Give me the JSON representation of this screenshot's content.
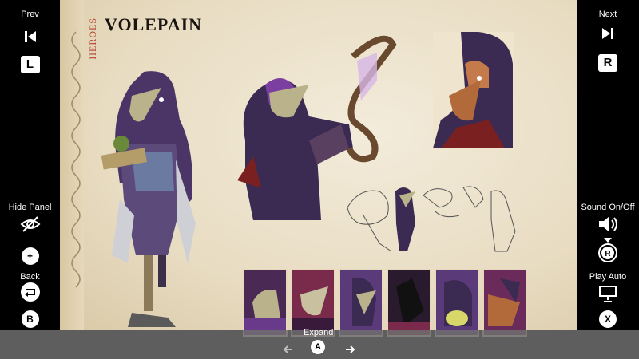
{
  "left_panel": {
    "prev_label": "Prev",
    "prev_key": "L",
    "hide_panel_label": "Hide Panel",
    "back_label": "Back",
    "back_key": "B"
  },
  "right_panel": {
    "next_label": "Next",
    "next_key": "R",
    "sound_label": "Sound On/Off",
    "sound_key": "R",
    "play_auto_label": "Play Auto",
    "play_auto_key": "X"
  },
  "page": {
    "category": "HEROES",
    "title": "VOLEPAIN"
  },
  "bottom_bar": {
    "expand_label": "Expand",
    "expand_key": "A"
  },
  "colors": {
    "parchment": "#efe5cf",
    "accent_red": "#b2402c",
    "purple": "#5b3a7a"
  },
  "thumbnails": [
    "card-1",
    "card-2",
    "card-3",
    "card-4",
    "card-5",
    "card-6"
  ]
}
